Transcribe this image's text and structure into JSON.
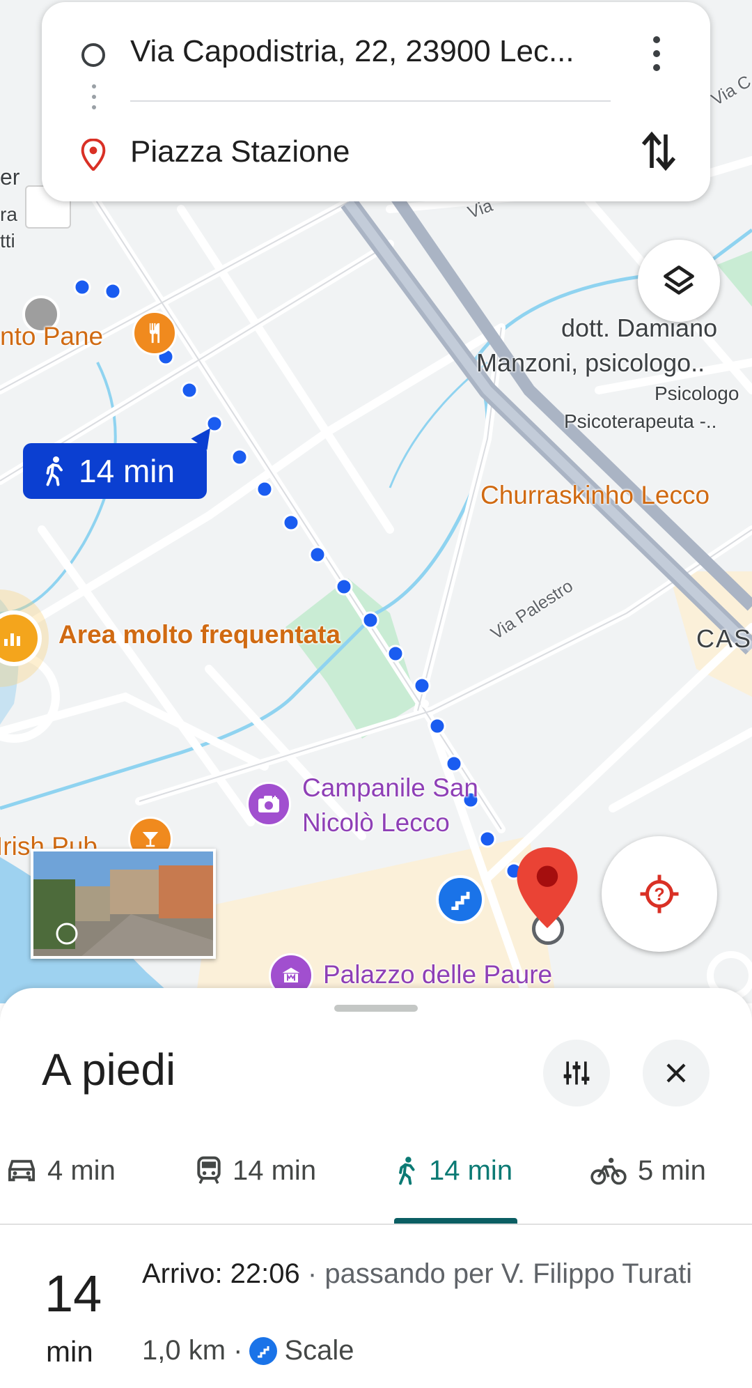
{
  "search": {
    "origin": "Via Capodistria, 22, 23900 Lec...",
    "destination": "Piazza Stazione"
  },
  "map": {
    "poi_pane": "nto Pane",
    "poi_psicologo_1": "dott. Damiano",
    "poi_psicologo_2": "Manzoni, psicologo..",
    "poi_psicologo_3": "Psicologo",
    "poi_psicologo_4": "Psicoterapeuta -..",
    "poi_churraskinho": "Churraskinho Lecco",
    "poi_busy_area": "Area molto frequentata",
    "poi_campanile_1": "Campanile San",
    "poi_campanile_2": "Nicolò Lecco",
    "poi_palazzo": "Palazzo delle Paure",
    "poi_irish": "Irish Pub",
    "poi_partial_er": "er",
    "poi_partial_ra": "ra",
    "poi_partial_tti": "tti",
    "poi_cas": "CAS",
    "street_palestro": "Via Palestro",
    "street_via_top": "Via",
    "street_via_right": "Via C",
    "walk_chip": "14 min"
  },
  "sheet": {
    "title": "A piedi",
    "modes": [
      {
        "name": "car",
        "label": "4 min"
      },
      {
        "name": "transit",
        "label": "14 min"
      },
      {
        "name": "walk",
        "label": "14 min",
        "active": true
      },
      {
        "name": "bike",
        "label": "5 min"
      }
    ],
    "duration_num": "14",
    "duration_unit": "min",
    "arrival": "Arrivo: 22:06",
    "via": " · passando per V. Filippo Turati",
    "distance": "1,0 km ·",
    "feature": "Scale"
  },
  "colors": {
    "route_blue": "#1a5cf0",
    "accent_teal": "#0b7a74",
    "poi_orange": "#d06a12",
    "poi_purple": "#8e3fb6",
    "pin_red": "#ea4335"
  },
  "icons": [
    "origin-circle-icon",
    "destination-pin-icon",
    "more-vert-icon",
    "swap-icon",
    "layers-icon",
    "walk-icon",
    "restaurant-icon",
    "bar-icon",
    "camera-icon",
    "museum-icon",
    "busy-area-icon",
    "stairs-icon",
    "location-target-icon",
    "tune-icon",
    "close-icon",
    "car-icon",
    "transit-icon",
    "bike-icon"
  ]
}
